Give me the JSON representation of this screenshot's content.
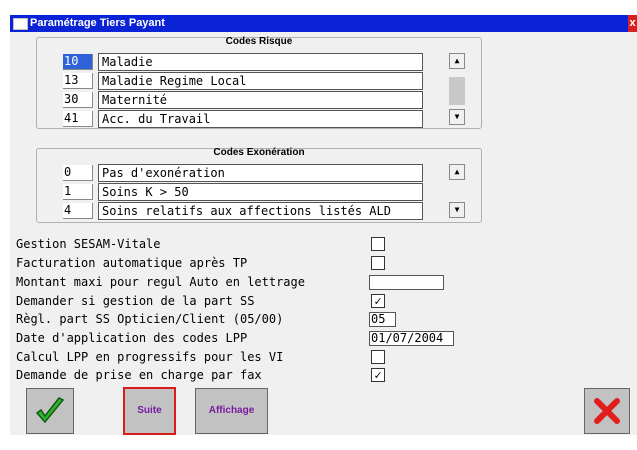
{
  "window": {
    "title": "Paramétrage Tiers Payant",
    "close_label": "x"
  },
  "codes_risque": {
    "title": "Codes Risque",
    "items": [
      {
        "code": "10",
        "label": "Maladie"
      },
      {
        "code": "13",
        "label": "Maladie Regime Local"
      },
      {
        "code": "30",
        "label": "Maternité"
      },
      {
        "code": "41",
        "label": "Acc. du Travail"
      }
    ]
  },
  "codes_exoneration": {
    "title": "Codes Exonération",
    "items": [
      {
        "code": "0",
        "label": "Pas d'exonération"
      },
      {
        "code": "1",
        "label": "Soins K > 50"
      },
      {
        "code": "4",
        "label": "Soins relatifs aux affections listés ALD"
      }
    ]
  },
  "options": [
    {
      "label": "Gestion SESAM-Vitale",
      "type": "checkbox",
      "checked": false,
      "mark": ""
    },
    {
      "label": "Facturation automatique après TP",
      "type": "checkbox",
      "checked": false,
      "mark": ""
    },
    {
      "label": "Montant maxi pour regul Auto en lettrage",
      "type": "text",
      "value": ""
    },
    {
      "label": "Demander si gestion de la part SS",
      "type": "checkbox",
      "checked": true,
      "mark": "✓"
    },
    {
      "label": "Règl. part SS Opticien/Client (05/00)",
      "type": "text",
      "value": "05"
    },
    {
      "label": "Date d'application des codes LPP",
      "type": "text",
      "value": "01/07/2004"
    },
    {
      "label": "Calcul LPP en progressifs pour les VI",
      "type": "checkbox",
      "checked": false,
      "mark": ""
    },
    {
      "label": "Demande de prise en charge par fax",
      "type": "checkbox",
      "checked": true,
      "mark": "✓"
    }
  ],
  "buttons": {
    "validate_icon": "green-check-icon",
    "suite": "Suite",
    "affichage": "Affichage",
    "cancel_icon": "red-x-icon"
  },
  "colors": {
    "title_bar": "#0a23d6",
    "selected_code": "#2f62d8",
    "button_text": "#7a1aa0",
    "focus_border": "#d91d1d"
  }
}
